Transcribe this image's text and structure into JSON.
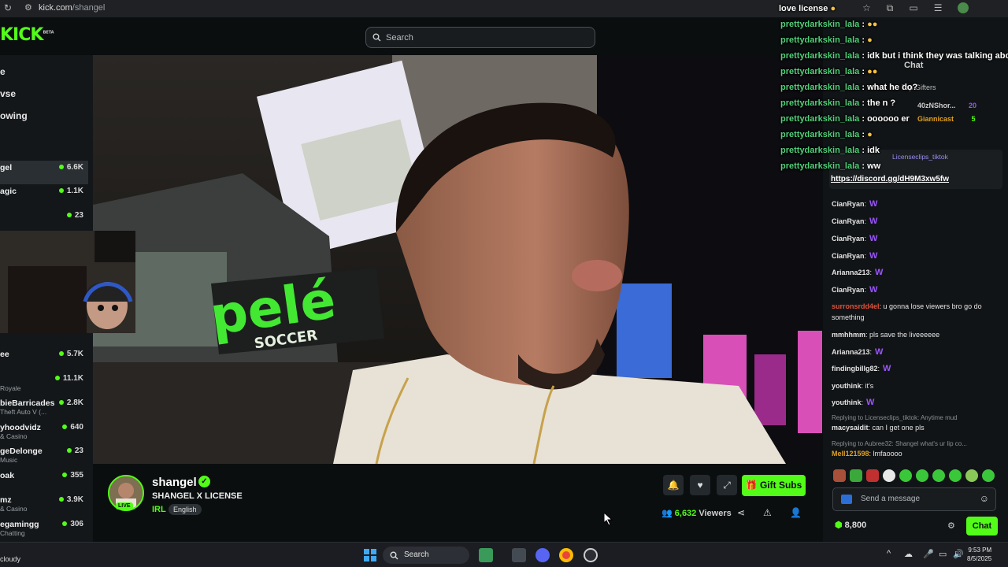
{
  "browser": {
    "url_host": "kick.com",
    "url_path": "/shangel"
  },
  "header": {
    "logo": "KICK",
    "logo_beta": "BETA",
    "search_placeholder": "Search"
  },
  "sidebar": {
    "nav": [
      "e",
      "vse",
      "owing"
    ],
    "channels": [
      {
        "name": "gel",
        "sub": "",
        "viewers": "6.6K",
        "active": true
      },
      {
        "name": "agic",
        "sub": "",
        "viewers": "1.1K"
      },
      {
        "name": "",
        "sub": "",
        "viewers": "23"
      },
      {
        "name": "ee",
        "sub": "",
        "viewers": "5.7K"
      },
      {
        "name": "",
        "sub": "Royale",
        "viewers": "11.1K"
      },
      {
        "name": "bieBarricades",
        "sub": "Theft Auto V (...",
        "viewers": "2.8K"
      },
      {
        "name": "yhoodvidz",
        "sub": "& Casino",
        "viewers": "640"
      },
      {
        "name": "geDelonge",
        "sub": "Music",
        "viewers": "23"
      },
      {
        "name": "oak",
        "sub": "",
        "viewers": "355"
      },
      {
        "name": "mz",
        "sub": "& Casino",
        "viewers": "3.9K"
      },
      {
        "name": "egamingg",
        "sub": "Chatting",
        "viewers": "306"
      }
    ]
  },
  "stream": {
    "streamer": "shangel",
    "title": "SHANGEL X LICENSE",
    "category": "IRL",
    "language": "English",
    "live": "LIVE",
    "gift_subs": "Gift Subs",
    "viewer_count": "6,632",
    "viewers_label": "Viewers",
    "scene_text_big": "pelé",
    "scene_text_small": "SOCCER"
  },
  "chat": {
    "title": "Chat",
    "top_gifters_label": "Top Gifters",
    "gifters": [
      {
        "name": "40zNShor...",
        "count": "20"
      },
      {
        "name": "Giannicast",
        "count": "5"
      }
    ],
    "pinned_user": "Licenseclips_tiktok",
    "pinned_link": "https://discord.gg/dH9M3xw5fw",
    "messages": [
      {
        "user": "CianRyan",
        "text": "",
        "color": "#4fd08a",
        "badge": true
      },
      {
        "user": "CianRyan",
        "text": "",
        "color": "#4fd08a",
        "badge": true
      },
      {
        "user": "CianRyan",
        "text": "",
        "color": "#4fd08a",
        "badge": true
      },
      {
        "user": "CianRyan",
        "text": "",
        "color": "#4fd08a",
        "badge": true
      },
      {
        "user": "Arianna213",
        "text": "",
        "color": "#4fd08a",
        "badge": true
      },
      {
        "user": "CianRyan",
        "text": "",
        "color": "#4fd08a",
        "badge": true
      },
      {
        "user": "surronsrdd4el",
        "text": "u gonna lose viewers bro go do something",
        "color": "#e0503a",
        "badge": false
      },
      {
        "user": "mmhhmm",
        "text": "pls save the liveeeeee",
        "color": "#4fd08a",
        "badge": false
      },
      {
        "user": "Arianna213",
        "text": "",
        "color": "#4fd08a",
        "badge": true
      },
      {
        "user": "findingbillg82",
        "text": "",
        "color": "#4fd08a",
        "badge": true
      },
      {
        "user": "youthink",
        "text": "it's",
        "color": "#4fd08a",
        "badge": false
      },
      {
        "user": "youthink",
        "text": "",
        "color": "#4fd08a",
        "badge": true
      },
      {
        "user": "macysaidit",
        "text": "can I get one pls",
        "color": "#4fd08a",
        "badge": false
      },
      {
        "user": "Mell121598",
        "text": "lmfaoooo",
        "color": "#e0a020",
        "badge": false
      }
    ],
    "replies": [
      "Replying to Licenseclips_tiktok: Anytime mud",
      "Replying to Aubree32: Shangel what's ur lip co..."
    ],
    "input_placeholder": "Send a message",
    "points": "8,800",
    "send_button": "Chat"
  },
  "overlay_chat": {
    "header": "love license",
    "lines": [
      {
        "user": "prettydarkskin_lala",
        "text": ""
      },
      {
        "user": "prettydarkskin_lala",
        "text": ""
      },
      {
        "user": "prettydarkskin_lala",
        "text": "idk but i think they was talking abou"
      },
      {
        "user": "prettydarkskin_lala",
        "text": ""
      },
      {
        "user": "prettydarkskin_lala",
        "text": "what he do?"
      },
      {
        "user": "prettydarkskin_lala",
        "text": "the n ?"
      },
      {
        "user": "prettydarkskin_lala",
        "text": "oooooo er"
      },
      {
        "user": "prettydarkskin_lala",
        "text": ""
      },
      {
        "user": "prettydarkskin_lala",
        "text": "idk"
      },
      {
        "user": "prettydarkskin_lala",
        "text": "ww"
      }
    ]
  },
  "taskbar": {
    "weather": "cloudy",
    "search": "Search",
    "time": "9:53 PM",
    "date": "8/5/2025"
  },
  "colors": {
    "brand": "#53fc18",
    "background": "#0b0e0f"
  }
}
